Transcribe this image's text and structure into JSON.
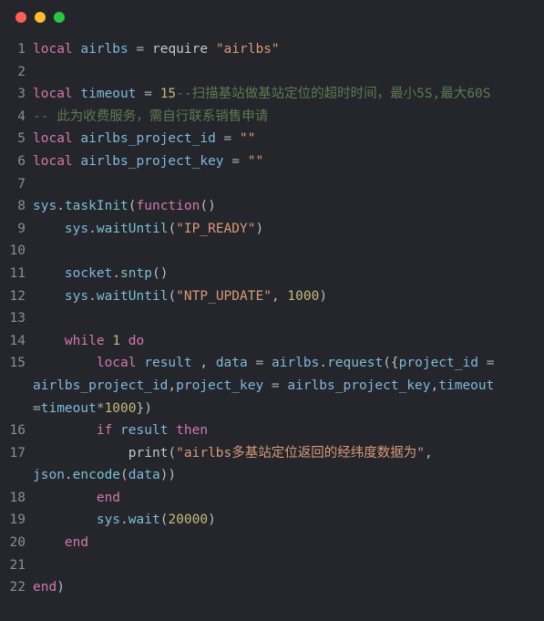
{
  "window": {
    "title_bar": {
      "buttons": [
        {
          "name": "close",
          "label": "",
          "color": "#ff5f57"
        },
        {
          "name": "minimize",
          "label": "",
          "color": "#febc2e"
        },
        {
          "name": "maximize",
          "label": "",
          "color": "#28c840"
        }
      ]
    }
  },
  "editor": {
    "language": "lua",
    "background": "#24262b",
    "gutter_color": "#8b8e95",
    "colors": {
      "keyword": "#d377b0",
      "identifier": "#7fb8dd",
      "function": "#79c0d4",
      "string": "#d99a78",
      "number": "#c3bb7a",
      "comment": "#5f7a52",
      "operator": "#a7abb3",
      "plain": "#c5c9d0"
    },
    "lines": [
      {
        "number": "1",
        "text": "local airlbs = require \"airlbs\"",
        "tokens": [
          {
            "t": "local",
            "c": "kw"
          },
          {
            "t": " ",
            "c": "plain"
          },
          {
            "t": "airlbs",
            "c": "id"
          },
          {
            "t": " ",
            "c": "plain"
          },
          {
            "t": "=",
            "c": "op"
          },
          {
            "t": " ",
            "c": "plain"
          },
          {
            "t": "require",
            "c": "plain"
          },
          {
            "t": " ",
            "c": "plain"
          },
          {
            "t": "\"airlbs\"",
            "c": "str"
          }
        ]
      },
      {
        "number": "2",
        "text": "",
        "tokens": []
      },
      {
        "number": "3",
        "text": "local timeout = 15--扫描基站做基站定位的超时时间，最小5S,最大60S",
        "tokens": [
          {
            "t": "local",
            "c": "kw"
          },
          {
            "t": " ",
            "c": "plain"
          },
          {
            "t": "timeout",
            "c": "id"
          },
          {
            "t": " ",
            "c": "plain"
          },
          {
            "t": "=",
            "c": "op"
          },
          {
            "t": " ",
            "c": "plain"
          },
          {
            "t": "15",
            "c": "num"
          },
          {
            "t": "--扫描基站做基站定位的超时时间，最小5S,最大60S",
            "c": "com"
          }
        ]
      },
      {
        "number": "4",
        "text": "-- 此为收费服务，需自行联系销售申请",
        "tokens": [
          {
            "t": "-- 此为收费服务，需自行联系销售申请",
            "c": "com"
          }
        ]
      },
      {
        "number": "5",
        "text": "local airlbs_project_id = \"\"",
        "tokens": [
          {
            "t": "local",
            "c": "kw"
          },
          {
            "t": " ",
            "c": "plain"
          },
          {
            "t": "airlbs_project_id",
            "c": "id"
          },
          {
            "t": " ",
            "c": "plain"
          },
          {
            "t": "=",
            "c": "op"
          },
          {
            "t": " ",
            "c": "plain"
          },
          {
            "t": "\"\"",
            "c": "str"
          }
        ]
      },
      {
        "number": "6",
        "text": "local airlbs_project_key = \"\"",
        "tokens": [
          {
            "t": "local",
            "c": "kw"
          },
          {
            "t": " ",
            "c": "plain"
          },
          {
            "t": "airlbs_project_key",
            "c": "id"
          },
          {
            "t": " ",
            "c": "plain"
          },
          {
            "t": "=",
            "c": "op"
          },
          {
            "t": " ",
            "c": "plain"
          },
          {
            "t": "\"\"",
            "c": "str"
          }
        ]
      },
      {
        "number": "7",
        "text": "",
        "tokens": []
      },
      {
        "number": "8",
        "text": "sys.taskInit(function()",
        "tokens": [
          {
            "t": "sys",
            "c": "id"
          },
          {
            "t": ".",
            "c": "punc"
          },
          {
            "t": "taskInit",
            "c": "fn"
          },
          {
            "t": "(",
            "c": "punc"
          },
          {
            "t": "function",
            "c": "kw"
          },
          {
            "t": "()",
            "c": "punc"
          }
        ]
      },
      {
        "number": "9",
        "text": "    sys.waitUntil(\"IP_READY\")",
        "tokens": [
          {
            "t": "    ",
            "c": "plain"
          },
          {
            "t": "sys",
            "c": "id"
          },
          {
            "t": ".",
            "c": "punc"
          },
          {
            "t": "waitUntil",
            "c": "fn"
          },
          {
            "t": "(",
            "c": "punc"
          },
          {
            "t": "\"IP_READY\"",
            "c": "str"
          },
          {
            "t": ")",
            "c": "punc"
          }
        ]
      },
      {
        "number": "10",
        "text": "",
        "tokens": []
      },
      {
        "number": "11",
        "text": "    socket.sntp()",
        "tokens": [
          {
            "t": "    ",
            "c": "plain"
          },
          {
            "t": "socket",
            "c": "id"
          },
          {
            "t": ".",
            "c": "punc"
          },
          {
            "t": "sntp",
            "c": "fn"
          },
          {
            "t": "()",
            "c": "punc"
          }
        ]
      },
      {
        "number": "12",
        "text": "    sys.waitUntil(\"NTP_UPDATE\", 1000)",
        "tokens": [
          {
            "t": "    ",
            "c": "plain"
          },
          {
            "t": "sys",
            "c": "id"
          },
          {
            "t": ".",
            "c": "punc"
          },
          {
            "t": "waitUntil",
            "c": "fn"
          },
          {
            "t": "(",
            "c": "punc"
          },
          {
            "t": "\"NTP_UPDATE\"",
            "c": "str"
          },
          {
            "t": ", ",
            "c": "punc"
          },
          {
            "t": "1000",
            "c": "num"
          },
          {
            "t": ")",
            "c": "punc"
          }
        ]
      },
      {
        "number": "13",
        "text": "",
        "tokens": []
      },
      {
        "number": "14",
        "text": "    while 1 do",
        "tokens": [
          {
            "t": "    ",
            "c": "plain"
          },
          {
            "t": "while",
            "c": "kw"
          },
          {
            "t": " ",
            "c": "plain"
          },
          {
            "t": "1",
            "c": "num"
          },
          {
            "t": " ",
            "c": "plain"
          },
          {
            "t": "do",
            "c": "kw"
          }
        ]
      },
      {
        "number": "15",
        "text": "        local result , data = airlbs.request({project_id = airlbs_project_id,project_key = airlbs_project_key,timeout =timeout*1000})",
        "tokens": [
          {
            "t": "        ",
            "c": "plain"
          },
          {
            "t": "local",
            "c": "kw"
          },
          {
            "t": " ",
            "c": "plain"
          },
          {
            "t": "result",
            "c": "id"
          },
          {
            "t": " , ",
            "c": "punc"
          },
          {
            "t": "data",
            "c": "id"
          },
          {
            "t": " ",
            "c": "plain"
          },
          {
            "t": "=",
            "c": "op"
          },
          {
            "t": " ",
            "c": "plain"
          },
          {
            "t": "airlbs",
            "c": "id"
          },
          {
            "t": ".",
            "c": "punc"
          },
          {
            "t": "request",
            "c": "fn"
          },
          {
            "t": "({",
            "c": "punc"
          },
          {
            "t": "project_id",
            "c": "id"
          },
          {
            "t": " ",
            "c": "plain"
          },
          {
            "t": "=",
            "c": "op"
          },
          {
            "t": " ",
            "c": "plain"
          },
          {
            "t": "airlbs_project_id",
            "c": "id"
          },
          {
            "t": ",",
            "c": "punc"
          },
          {
            "t": "project_key",
            "c": "id"
          },
          {
            "t": " ",
            "c": "plain"
          },
          {
            "t": "=",
            "c": "op"
          },
          {
            "t": " ",
            "c": "plain"
          },
          {
            "t": "airlbs_project_key",
            "c": "id"
          },
          {
            "t": ",",
            "c": "punc"
          },
          {
            "t": "timeout",
            "c": "id"
          },
          {
            "t": " ",
            "c": "plain"
          },
          {
            "t": "=",
            "c": "op"
          },
          {
            "t": "timeout",
            "c": "id"
          },
          {
            "t": "*",
            "c": "op"
          },
          {
            "t": "1000",
            "c": "num"
          },
          {
            "t": "})",
            "c": "punc"
          }
        ]
      },
      {
        "number": "16",
        "text": "        if result then",
        "tokens": [
          {
            "t": "        ",
            "c": "plain"
          },
          {
            "t": "if",
            "c": "kw"
          },
          {
            "t": " ",
            "c": "plain"
          },
          {
            "t": "result",
            "c": "id"
          },
          {
            "t": " ",
            "c": "plain"
          },
          {
            "t": "then",
            "c": "kw"
          }
        ]
      },
      {
        "number": "17",
        "text": "            print(\"airlbs多基站定位返回的经纬度数据为\", json.encode(data))",
        "tokens": [
          {
            "t": "            ",
            "c": "plain"
          },
          {
            "t": "print",
            "c": "plain"
          },
          {
            "t": "(",
            "c": "punc"
          },
          {
            "t": "\"airlbs多基站定位返回的经纬度数据为\"",
            "c": "str"
          },
          {
            "t": ", ",
            "c": "punc"
          },
          {
            "t": "json",
            "c": "id"
          },
          {
            "t": ".",
            "c": "punc"
          },
          {
            "t": "encode",
            "c": "fn"
          },
          {
            "t": "(",
            "c": "punc"
          },
          {
            "t": "data",
            "c": "id"
          },
          {
            "t": "))",
            "c": "punc"
          }
        ]
      },
      {
        "number": "18",
        "text": "        end",
        "tokens": [
          {
            "t": "        ",
            "c": "plain"
          },
          {
            "t": "end",
            "c": "kw"
          }
        ]
      },
      {
        "number": "19",
        "text": "        sys.wait(20000)",
        "tokens": [
          {
            "t": "        ",
            "c": "plain"
          },
          {
            "t": "sys",
            "c": "id"
          },
          {
            "t": ".",
            "c": "punc"
          },
          {
            "t": "wait",
            "c": "fn"
          },
          {
            "t": "(",
            "c": "punc"
          },
          {
            "t": "20000",
            "c": "num"
          },
          {
            "t": ")",
            "c": "punc"
          }
        ]
      },
      {
        "number": "20",
        "text": "    end",
        "tokens": [
          {
            "t": "    ",
            "c": "plain"
          },
          {
            "t": "end",
            "c": "kw"
          }
        ]
      },
      {
        "number": "21",
        "text": "",
        "tokens": []
      },
      {
        "number": "22",
        "text": "end)",
        "tokens": [
          {
            "t": "end",
            "c": "kw"
          },
          {
            "t": ")",
            "c": "punc"
          }
        ]
      }
    ]
  }
}
